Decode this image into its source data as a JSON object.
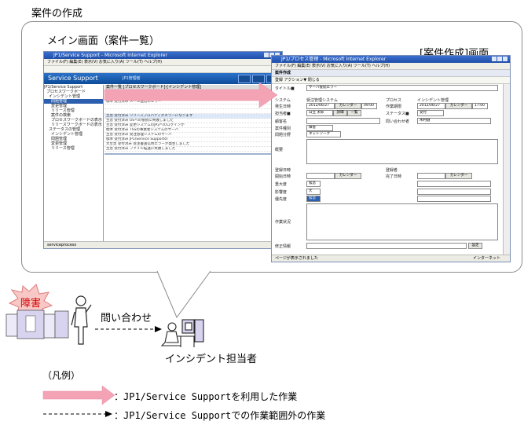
{
  "title": "案件の作成",
  "main_screen_label": "メイン画面（案件一覧）",
  "create_screen_label": "[案件作成]画面",
  "main_window": {
    "title": "JP1/Service Support - Microsoft Internet Explorer",
    "menu": "ファイル(F)   編集(E)   表示(V)   お気に入り(A)   ツール(T)   ヘルプ(H)",
    "banner": "Service Support",
    "banner_sub": "JP1管理者",
    "tree": [
      "JP1/Service Support",
      "プロセスワークボード",
      "インシデント管理",
      "問題管理",
      "変更管理",
      "リリース管理",
      "案件の検索",
      "プロセスワークボードの表示",
      "リリースワークボードの表示",
      "ステータスの管理",
      "インシデント管理",
      "問題管理",
      "変更管理",
      "リリース管理"
    ],
    "grid_header": "案件一覧  [プロセスワークボード]-[インシデント管理]",
    "grid_rows": [
      "大至急  クローズ  受注書送信時エラーが発生しました",
      "標準  クローズ  GUI操作の画面を",
      "標準  受付済み  メール送信のエラー",
      "",
      "",
      "至急  受付済み  リリースプロパティがエラーになります",
      "至急  受付済み  OSへの接続に失敗しました",
      "至急  受付済み  変更システムのJP2へのログインが",
      "標準  受付済み  TSSの事業者システムのサーバ",
      "至急  受付済み  受注管理システムのサーバ",
      "標準  受付済み  JP1/Service Supportの",
      "大至急  受付済み  受注書送信時エラーが発生しました",
      "至急  受付済み  ファイル転送に失敗しました"
    ],
    "status": "serviceprocess"
  },
  "create_window": {
    "title": "JP1/プロセス管理 - Microsoft Internet Explorer",
    "menu": "ファイル(F)   編集(E)   表示(V)   お気に入り(A)   ツール(T)   ヘルプ(H)",
    "header": "案件作成",
    "subbar": "登録  アクション▼  閉じる",
    "fields": {
      "title_label": "タイトル■",
      "title_value": "サーバ接続エラー",
      "system_label": "システム",
      "system_value": "受注管理システム",
      "process_label": "プロセス",
      "process_value": "インシデント管理",
      "occur_label": "発生日時",
      "occur_date": "2012/06/27",
      "occur_time": "09:00",
      "work_label": "作業期限",
      "work_date": "2012/06/27",
      "work_time": "17:00",
      "calendar": "カレンダー",
      "owner_label": "担当者■",
      "owner_value": "日立 太郎",
      "detail": "詳細",
      "list": "一覧",
      "status_label": "ステータス■",
      "status_value": "受付",
      "customer_label": "顧客名",
      "inquirer_label": "問い合わせ者",
      "inquirer_value": "木村健",
      "type_label": "案件種別",
      "type_value": "障害",
      "problem_label": "問題分野",
      "problem_value": "ネットワーク",
      "overview_label": "概要",
      "reg_label": "登録日時",
      "registrant_label": "登録者",
      "start_label": "開始日時",
      "end_label": "完了日時",
      "severity_label": "重大度",
      "severity_value": "緊急",
      "impact_label": "影響度",
      "impact_value": "大",
      "priority_label": "優先度",
      "priority_value": "緊急",
      "work_status_label": "作業状況",
      "mod_label": "修正情報",
      "set_button": "設定"
    },
    "status": "ページが表示されました",
    "internet": "インターネット"
  },
  "inquiry_label": "問い合わせ",
  "incident_label": "インシデント担当者",
  "failure_label": "障害",
  "legend": {
    "title": "（凡例）",
    "item1": "：JP1/Service Supportを利用した作業",
    "item2": "：JP1/Service Supportでの作業範囲外の作業"
  },
  "colors": {
    "pink_arrow": "#f4a3b5",
    "failure_star": "#f7c8c5",
    "server": "#d8d4f0",
    "banner": "#1f5fb3"
  }
}
